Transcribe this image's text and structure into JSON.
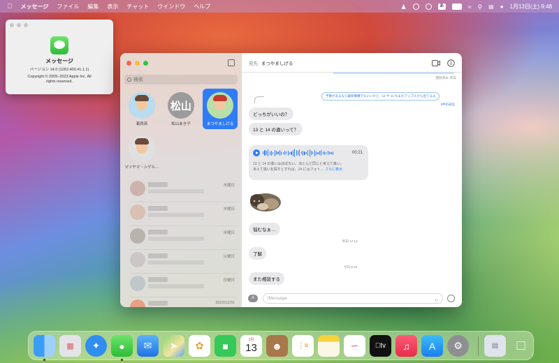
{
  "menubar": {
    "apple": "",
    "app_name": "メッセージ",
    "menus": [
      "ファイル",
      "編集",
      "表示",
      "チャット",
      "ウインドウ",
      "ヘルプ"
    ],
    "input_mode": "あ",
    "datetime": "1月13日(土) 9:48"
  },
  "about": {
    "app_name": "メッセージ",
    "version": "バージョン 14.0 (1262.400.41.1.1)",
    "copyright_line1": "Copyright © 2005–2023 Apple Inc. All",
    "copyright_line2": "rights reserved."
  },
  "sidebar": {
    "search_placeholder": "検索",
    "pinned": [
      {
        "name": "葛西亮",
        "initials": ""
      },
      {
        "name": "松山あき子",
        "initials": "松山"
      },
      {
        "name": "まつやましげる",
        "initials": ""
      },
      {
        "name": "マツヤマ・シゲル…",
        "initials": ""
      }
    ],
    "conversations": [
      {
        "day": "木曜日"
      },
      {
        "day": "木曜日"
      },
      {
        "day": "水曜日"
      },
      {
        "day": "火曜日"
      },
      {
        "day": "日曜日"
      },
      {
        "day": "2023/12/31"
      }
    ]
  },
  "chat": {
    "to_label": "宛先:",
    "recipient": "まつやましげる",
    "read_receipt": "開封済み: 昨日",
    "reply_quote": "予算があるなら最新機種でもいいけど、13 や 14 もまだアップルから出てるよ",
    "reply_count": "2件の返信",
    "messages": [
      "どっちがいいの？",
      "13 と 14 の違いって？",
      "悩むなぁ…",
      "了解",
      "また相談する"
    ],
    "voice": {
      "duration": "00:21",
      "transcript_line1": "13 と 14 の違いはほぼない。ほとんど同じと考えて良い。",
      "transcript_line2": "あえて違いを探すとすれば、14 にはフォト…",
      "more": "さらに表示"
    },
    "timestamp_yesterday": "昨日 17:13",
    "timestamp_today": "今日 8:45",
    "input_placeholder": "iMessage",
    "apps_button": "A"
  },
  "dock": {
    "calendar_month": "1月",
    "calendar_day": "13"
  },
  "colors": {
    "accent": "#2f7cf6",
    "bubble": "#e9e9eb",
    "close": "#ff5f57",
    "minimize": "#febc2e",
    "zoom": "#28c840"
  }
}
